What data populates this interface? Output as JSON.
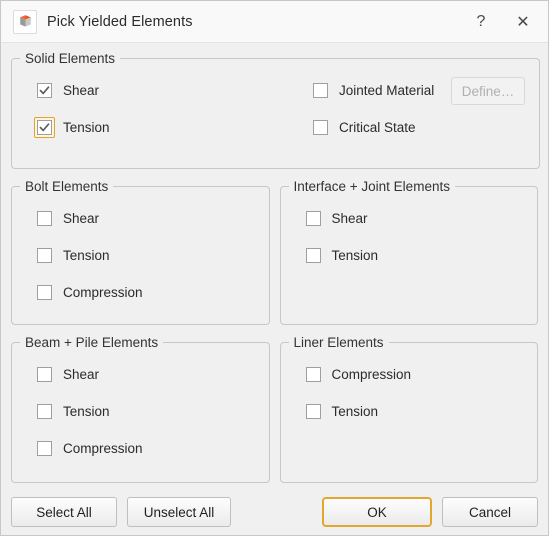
{
  "window": {
    "title": "Pick Yielded Elements",
    "icon": "cube-icon",
    "help_label": "?",
    "close_label": "✕",
    "accent_color": "#e3a72f",
    "focus_color": "#e0a526",
    "background_color": "#f0f0f0",
    "titlebar_color": "#f9f9f9"
  },
  "groups": [
    {
      "title": "Solid Elements",
      "name": "solid-elements",
      "left_items": [
        {
          "label": "Shear",
          "checked": true,
          "focused": false
        },
        {
          "label": "Tension",
          "checked": true,
          "focused": true
        }
      ],
      "right_items": [
        {
          "label": "Jointed Material",
          "checked": false,
          "focused": false
        },
        {
          "label": "Critical State",
          "checked": false,
          "focused": false
        }
      ],
      "define_button": {
        "label": "Define…",
        "disabled": true
      }
    },
    {
      "title": "Bolt Elements",
      "name": "bolt-elements",
      "items": [
        {
          "label": "Shear",
          "checked": false,
          "focused": false
        },
        {
          "label": "Tension",
          "checked": false,
          "focused": false
        },
        {
          "label": "Compression",
          "checked": false,
          "focused": false
        }
      ]
    },
    {
      "title": "Interface + Joint Elements",
      "name": "interface-joint-elements",
      "items": [
        {
          "label": "Shear",
          "checked": false,
          "focused": false
        },
        {
          "label": "Tension",
          "checked": false,
          "focused": false
        }
      ]
    },
    {
      "title": "Beam + Pile Elements",
      "name": "beam-pile-elements",
      "items": [
        {
          "label": "Shear",
          "checked": false,
          "focused": false
        },
        {
          "label": "Tension",
          "checked": false,
          "focused": false
        },
        {
          "label": "Compression",
          "checked": false,
          "focused": false
        }
      ]
    },
    {
      "title": "Liner Elements",
      "name": "liner-elements",
      "items": [
        {
          "label": "Compression",
          "checked": false,
          "focused": false
        },
        {
          "label": "Tension",
          "checked": false,
          "focused": false
        }
      ]
    }
  ],
  "footer": {
    "select_all_label": "Select All",
    "unselect_all_label": "Unselect All",
    "ok_label": "OK",
    "cancel_label": "Cancel",
    "default_button": "OK"
  }
}
